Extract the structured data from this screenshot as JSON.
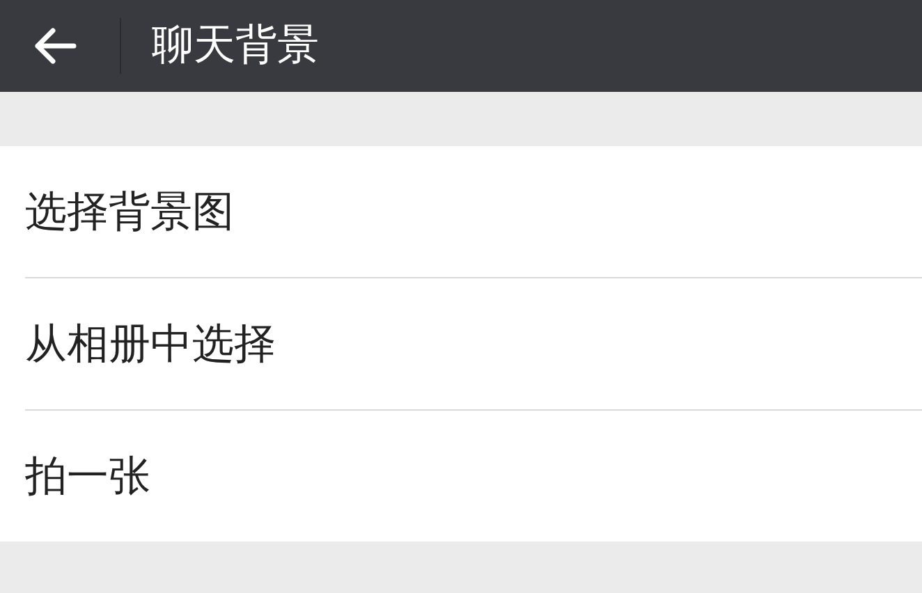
{
  "header": {
    "title": "聊天背景"
  },
  "items": [
    {
      "label": "选择背景图"
    },
    {
      "label": "从相册中选择"
    },
    {
      "label": "拍一张"
    }
  ]
}
